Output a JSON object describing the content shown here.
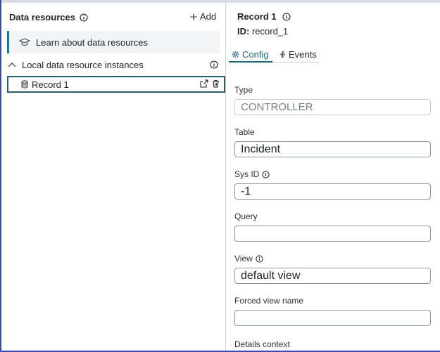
{
  "left": {
    "title": "Data resources",
    "add_label": "Add",
    "learn_label": "Learn about data resources",
    "section_label": "Local data resource instances",
    "records": [
      {
        "label": "Record 1"
      }
    ]
  },
  "right": {
    "title": "Record 1",
    "id_prefix": "ID:",
    "id_value": "record_1",
    "tabs": [
      {
        "label": "Config"
      },
      {
        "label": "Events"
      }
    ],
    "fields": {
      "type": {
        "label": "Type",
        "value": "CONTROLLER"
      },
      "table": {
        "label": "Table",
        "value": "Incident"
      },
      "sys_id": {
        "label": "Sys ID",
        "value": "-1"
      },
      "query": {
        "label": "Query",
        "value": ""
      },
      "view": {
        "label": "View",
        "value": "default view"
      },
      "forced_view_name": {
        "label": "Forced view name",
        "value": ""
      },
      "details_context": {
        "label": "Details context"
      }
    }
  },
  "colors": {
    "accent": "#1c6b7a",
    "selected_border": "#2a5f73",
    "left_edge": "#3b49a8"
  }
}
